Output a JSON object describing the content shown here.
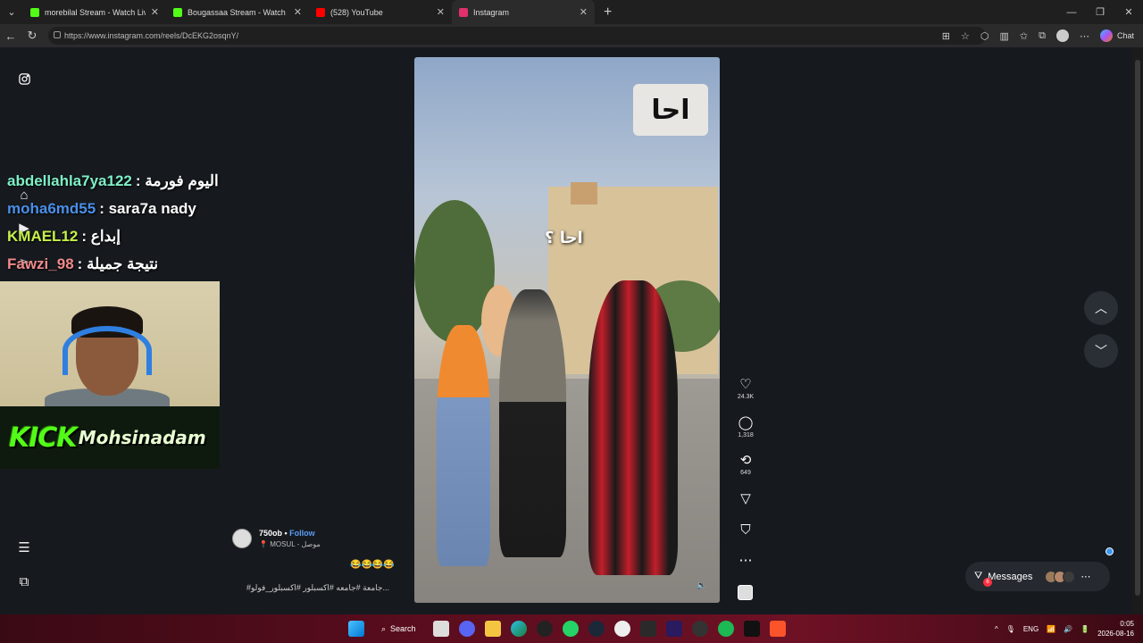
{
  "browser": {
    "tabs": [
      {
        "title": "morebilal Stream - Watch Live",
        "favicon_color": "#53fc18",
        "active": false
      },
      {
        "title": "Bougassaa Stream - Watch Live",
        "favicon_color": "#53fc18",
        "active": false
      },
      {
        "title": "(528) YouTube",
        "favicon_color": "#ff0000",
        "active": false
      },
      {
        "title": "Instagram",
        "favicon_color": "#e1306c",
        "active": true
      }
    ],
    "url": "https://www.instagram.com/reels/DcEKG2osqnY/",
    "chat_label": "Chat"
  },
  "stream_chat": [
    {
      "user": "abdellahla7ya122",
      "user_color": "#7ef0c6",
      "message": "اليوم فورمة"
    },
    {
      "user": "moha6md55",
      "user_color": "#4a8fe8",
      "message": "sara7a nady"
    },
    {
      "user": "KMAEL12",
      "user_color": "#c6f04a",
      "message": "إبداع"
    },
    {
      "user": "Fawzi_98",
      "user_color": "#f08a8a",
      "message": "نتيجة جميلة"
    }
  ],
  "stream_banner": {
    "brand": "KICK",
    "name": "Mohsinadam"
  },
  "reel": {
    "author": "750ob",
    "follow_label": "Follow",
    "location": "MOSUL - موصل",
    "emojis": "😂😂😂😂",
    "hashtags": "#جامعة #جامعه #اكسبلور #اكسبلور_فولو...",
    "overlay_text": "احا",
    "caption_text": "احا ؟"
  },
  "actions": {
    "likes": "24.3K",
    "comments": "1,318",
    "reposts": "649"
  },
  "messages": {
    "label": "Messages",
    "badge": "6"
  },
  "taskbar": {
    "search_label": "Search",
    "language": "ENG",
    "time": "0:05",
    "date": "2026-08-16"
  }
}
